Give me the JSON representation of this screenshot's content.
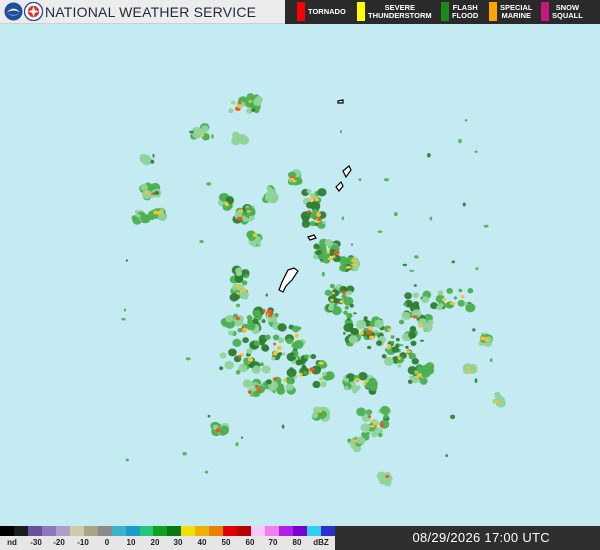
{
  "header": {
    "title": "NATIONAL WEATHER SERVICE",
    "logos": [
      "noaa-logo",
      "nws-logo"
    ]
  },
  "warning_legend": [
    {
      "label_lines": [
        "TORNADO"
      ],
      "color": "#ff0000"
    },
    {
      "label_lines": [
        "SEVERE",
        "THUNDERSTORM"
      ],
      "color": "#ffff00"
    },
    {
      "label_lines": [
        "FLASH",
        "FLOOD"
      ],
      "color": "#1a8a1a"
    },
    {
      "label_lines": [
        "SPECIAL",
        "MARINE"
      ],
      "color": "#ffa500"
    },
    {
      "label_lines": [
        "SNOW",
        "SQUALL"
      ],
      "color": "#c71585"
    }
  ],
  "reflectivity_scale": {
    "unit": "dBZ",
    "labels": [
      "nd",
      "-30",
      "-20",
      "-10",
      "0",
      "10",
      "20",
      "30",
      "40",
      "50",
      "60",
      "70",
      "80",
      "dBZ"
    ],
    "colors": [
      "#000000",
      "#1c1c1c",
      "#6a4f9a",
      "#8a78b8",
      "#a9a0c8",
      "#cfcaa8",
      "#a8a48c",
      "#8a8a8a",
      "#3ab4c8",
      "#1c9cc8",
      "#24c878",
      "#10a020",
      "#0a7a10",
      "#f0e000",
      "#f0b000",
      "#e88000",
      "#e00000",
      "#b80000",
      "#f8c8f8",
      "#f080f0",
      "#b020e8",
      "#7a00d0",
      "#30d0f0",
      "#3030c8"
    ]
  },
  "timestamp": "08/29/2026 17:00 UTC",
  "map": {
    "background": "#c4eaf2",
    "land_fill": "#ffffff",
    "land_stroke": "#000000",
    "echo_colors": {
      "light": "#8fd49a",
      "moderate": "#4caf50",
      "heavy": "#2e7d32",
      "intense": "#f4c430",
      "extreme": "#e85a20"
    }
  }
}
